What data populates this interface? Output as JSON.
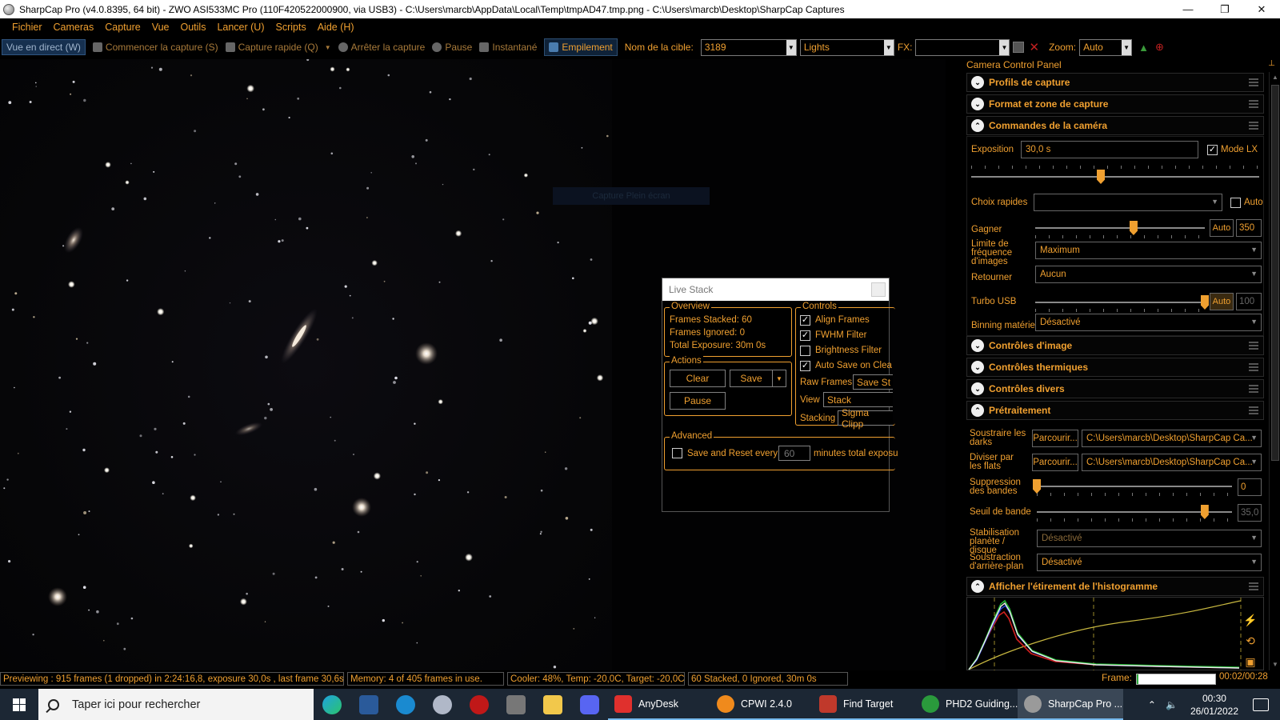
{
  "window": {
    "title": "SharpCap Pro (v4.0.8395, 64 bit) - ZWO ASI533MC Pro (110F420522000900, via USB3) - C:\\Users\\marcb\\AppData\\Local\\Temp\\tmpAD47.tmp.png - C:\\Users\\marcb\\Desktop\\SharpCap Captures",
    "minimize": "—",
    "restore": "❐",
    "close": "✕"
  },
  "menu": [
    "Fichier",
    "Cameras",
    "Capture",
    "Vue",
    "Outils",
    "Lancer (U)",
    "Scripts",
    "Aide (H)"
  ],
  "toolbar": {
    "live_view": "Vue en direct (W)",
    "start_capture": "Commencer la capture (S)",
    "quick_capture": "Capture rapide (Q)",
    "stop_capture": "Arrêter la capture",
    "pause": "Pause",
    "snapshot": "Instantané",
    "stacking": "Empilement",
    "target_label": "Nom de la cible:",
    "target_value": "3189",
    "frame_type": "Lights",
    "fx_label": "FX:",
    "fx_value": "",
    "zoom_label": "Zoom:",
    "zoom_value": "Auto"
  },
  "ghost_button": "Capture Plein écran",
  "live_stack": {
    "title": "Live Stack",
    "overview_title": "Overview",
    "frames_stacked": "Frames Stacked: 60",
    "frames_ignored": "Frames Ignored:  0",
    "total_exposure": "Total Exposure:   30m 0s",
    "actions_title": "Actions",
    "clear": "Clear",
    "save": "Save",
    "pause": "Pause",
    "controls_title": "Controls",
    "align_frames": "Align Frames",
    "fwhm_filter": "FWHM Filter",
    "brightness_filter": "Brightness Filter",
    "auto_save": "Auto Save on Clea",
    "raw_frames_label": "Raw Frames",
    "raw_frames_value": "Save St",
    "view_label": "View",
    "view_value": "Stack",
    "stacking_label": "Stacking",
    "stacking_value": "Sigma Clipp",
    "advanced_title": "Advanced",
    "save_reset_label": "Save and Reset every",
    "save_reset_value": "60",
    "save_reset_suffix": "minutes total exposu",
    "checks": {
      "align_frames": true,
      "fwhm_filter": true,
      "brightness_filter": false,
      "auto_save": true,
      "save_reset": false
    }
  },
  "panel": {
    "title": "Camera Control Panel",
    "sections": {
      "profiles": "Profils de capture",
      "format": "Format et zone de capture",
      "camera_controls": "Commandes de la caméra",
      "image_controls": "Contrôles d'image",
      "thermal": "Contrôles thermiques",
      "misc": "Contrôles divers",
      "preprocessing": "Prétraitement",
      "histogram": "Afficher l'étirement de l'histogramme"
    },
    "exposure_label": "Exposition",
    "exposure_value": "30,0 s",
    "lx_mode": "Mode LX",
    "lx_mode_checked": true,
    "quick_choice_label": "Choix rapides",
    "quick_choice_auto": "Auto",
    "exposure_slider": 0.45,
    "gain_label": "Gagner",
    "gain_auto": "Auto",
    "gain_value": "350",
    "gain_slider": 0.58,
    "framerate_label": "Limite de fréquence d'images",
    "framerate_value": "Maximum",
    "flip_label": "Retourner",
    "flip_value": "Aucun",
    "usb_label": "Turbo USB",
    "usb_auto": "Auto",
    "usb_value": "100",
    "usb_slider": 1.0,
    "binning_label": "Binning matériel",
    "binning_value": "Désactivé",
    "darks_label": "Soustraire les darks",
    "browse": "Parcourir...",
    "darks_path": "C:\\Users\\marcb\\Desktop\\SharpCap Ca...",
    "flats_label": "Diviser par les flats",
    "flats_path": "C:\\Users\\marcb\\Desktop\\SharpCap Ca...",
    "banding_label": "Suppression des bandes",
    "banding_value": "0",
    "banding_slider": 0.0,
    "band_threshold_label": "Seuil de bande",
    "band_threshold_value": "35,0",
    "band_threshold_slider": 0.86,
    "stabilization_label": "Stabilisation planète / disque",
    "stabilization_value": "Désactivé",
    "background_label": "Soustraction d'arrière-plan",
    "background_value": "Désactivé"
  },
  "status": {
    "preview": "Previewing : 915 frames (1 dropped) in 2:24:16,8, exposure 30,0s , last frame 30,6s",
    "memory": "Memory: 4 of 405 frames in use.",
    "cooler": "Cooler: 48%, Temp: -20,0C, Target: -20,0C",
    "stacked": "60 Stacked, 0 Ignored, 30m 0s",
    "frame_label": "Frame:",
    "frame_progress": 0.02,
    "frame_time": "00:02/00:28"
  },
  "taskbar": {
    "search_placeholder": "Taper ici pour rechercher",
    "apps": [
      "AnyDesk",
      "CPWI 2.4.0",
      "Find Target",
      "PHD2 Guiding...",
      "SharpCap Pro ..."
    ],
    "time": "00:30",
    "date": "26/01/2022",
    "colors": {
      "anydesk": "#e0302d",
      "cpwi": "#f08a1c",
      "phd2": "#2a9a3c",
      "sharpcap": "#9a9a9a",
      "findtarget": "#c0392b"
    }
  }
}
